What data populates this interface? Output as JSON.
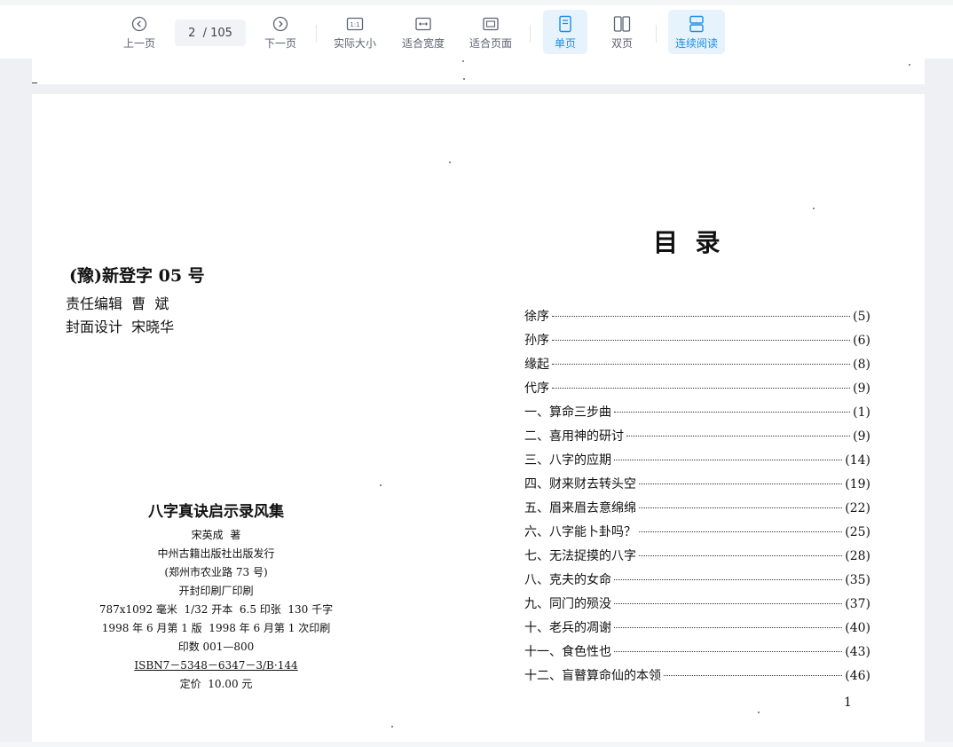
{
  "toolbar": {
    "prev_label": "上一页",
    "page_indicator": "2  / 105",
    "next_label": "下一页",
    "actual_size_label": "实际大小",
    "fit_width_label": "适合宽度",
    "fit_page_label": "适合页面",
    "single_page_label": "单页",
    "double_page_label": "双页",
    "continuous_label": "连续阅读",
    "accent_color": "#1a8ee6"
  },
  "left_page": {
    "registration": "(豫)新登字 05 号",
    "editor_line": "责任编辑  曹  斌",
    "cover_line": "封面设计  宋晓华",
    "colophon": {
      "title": "八字真诀启示录风集",
      "author": "宋英成  著",
      "publisher": "中州古籍出版社出版发行",
      "address": "(郑州市农业路 73 号)",
      "printer": "开封印刷厂印刷",
      "format": "787x1092 毫米  1/32 开本  6.5 印张  130 千字",
      "edition": "1998 年 6 月第 1 版  1998 年 6 月第 1 次印刷",
      "print_run": "印数 001—800",
      "isbn": "ISBN7－5348－6347－3/B·144",
      "price": "定价  10.00 元"
    }
  },
  "right_page": {
    "heading": "目  录",
    "entries": [
      {
        "title": "徐序",
        "page": "(5)"
      },
      {
        "title": "孙序",
        "page": "(6)"
      },
      {
        "title": "缘起",
        "page": "(8)"
      },
      {
        "title": "代序",
        "page": "(9)"
      },
      {
        "title": "一、算命三步曲",
        "page": "(1)"
      },
      {
        "title": "二、喜用神的研讨",
        "page": "(9)"
      },
      {
        "title": "三、八字的应期",
        "page": "(14)"
      },
      {
        "title": "四、财来财去转头空",
        "page": "(19)"
      },
      {
        "title": "五、眉来眉去意绵绵",
        "page": "(22)"
      },
      {
        "title": "六、八字能卜卦吗？",
        "page": "(25)"
      },
      {
        "title": "七、无法捉摸的八字",
        "page": "(28)"
      },
      {
        "title": "八、克夫的女命",
        "page": "(35)"
      },
      {
        "title": "九、同门的殒没",
        "page": "(37)"
      },
      {
        "title": "十、老兵的凋谢",
        "page": "(40)"
      },
      {
        "title": "十一、食色性也",
        "page": "(43)"
      },
      {
        "title": "十二、盲瞽算命仙的本领",
        "page": "(46)"
      }
    ],
    "page_number": "1"
  }
}
